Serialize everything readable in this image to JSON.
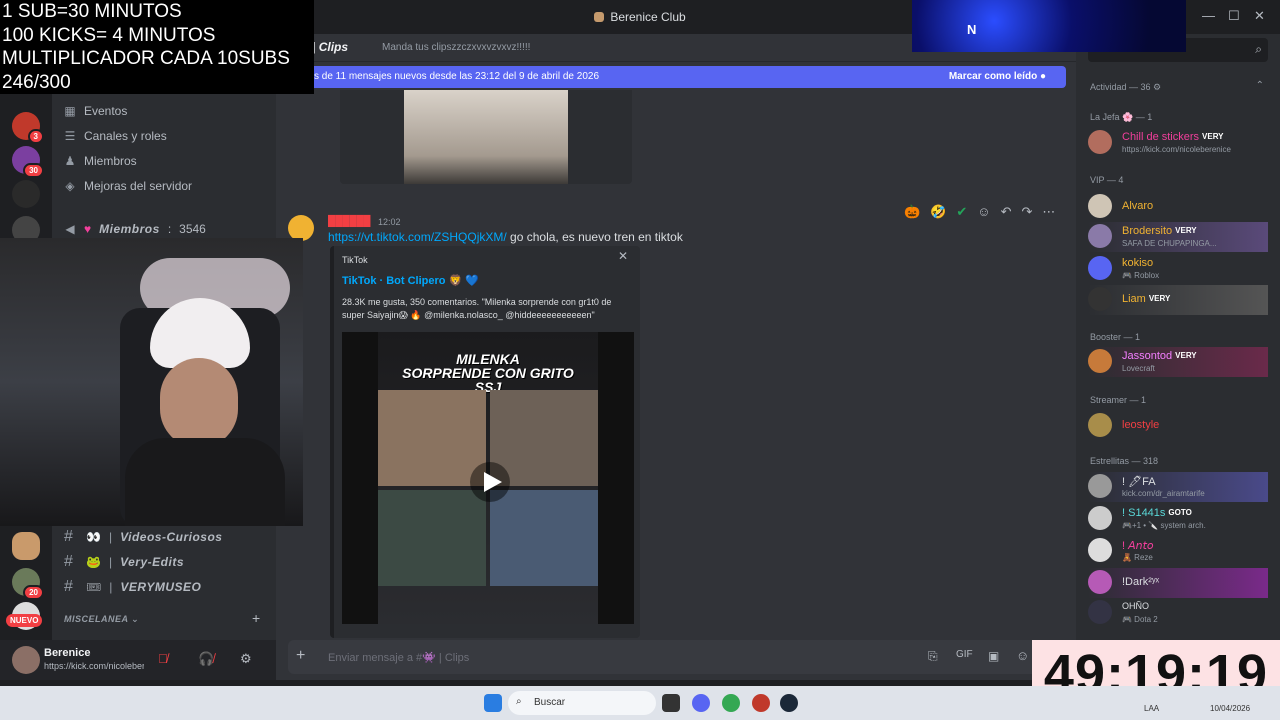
{
  "window": {
    "title": "Berenice Club",
    "controls": [
      "—",
      "☐",
      "✕"
    ]
  },
  "overlay": {
    "lines": [
      "1 SUB=30 MINUTOS",
      "100 KICKS= 4 MINUTOS",
      "MULTIPLICADOR CADA 10SUBS",
      "246/300"
    ],
    "timer": "49:19:19",
    "neon_text": "N"
  },
  "rail": {
    "badges": [
      "3",
      "30",
      "20"
    ],
    "new_pill": "NUEVO"
  },
  "sidebar": {
    "items": [
      {
        "icon": "calendar-icon",
        "label": "Eventos"
      },
      {
        "icon": "list-icon",
        "label": "Canales y roles"
      },
      {
        "icon": "people-icon",
        "label": "Miembros"
      },
      {
        "icon": "shield-icon",
        "label": "Mejoras del servidor"
      }
    ],
    "members_stat": {
      "label": "Miembros",
      "count": "3546"
    },
    "channels": [
      {
        "emoji": "👀",
        "name": "Videos-Curiosos"
      },
      {
        "emoji": "🐸",
        "name": "Very-Edits"
      },
      {
        "emoji": "🎟",
        "name": "VERYMUSEO"
      }
    ],
    "section": "MISCELANEA"
  },
  "user_panel": {
    "name": "Berenice",
    "status": "https://kick.com/nicoleber"
  },
  "chat": {
    "channel_name": "Clips",
    "topic": "Manda tus clipszzczxvxvzvxvz!!!!!",
    "new_messages": "s de 11 mensajes nuevos desde las 23:12 del 9 de abril de 2026",
    "mark_read": "Marcar como leído",
    "message": {
      "author": "██████",
      "time": "12:02",
      "link": "https://vt.tiktok.com/ZSHQQjkXM/",
      "text": " go chola, es nuevo tren en tiktok"
    },
    "embed": {
      "provider": "TikTok",
      "title": "TikTok · Bot Clipero 🦁 💙",
      "description": "28.3K me gusta, 350 comentarios. \"Milenka sorprende con gr1t0 de super Saiyajin😱 🔥 @milenka.nolasco_ @hiddeeeeeeeeeeen\"",
      "video_title": [
        "MILENKA",
        "SORPRENDE CON GRITO",
        "SSJ"
      ]
    },
    "composer_placeholder": "Enviar mensaje a #👾 | Clips"
  },
  "members": {
    "groups": [
      {
        "title": "Actividad — 36",
        "members": []
      },
      {
        "title": "La Jefa 🌸 — 1",
        "members": [
          {
            "name": "Chill de stickers",
            "tag": "VERY",
            "sub": "https://kick.com/nicoleberenice",
            "color": "#f23f9c"
          }
        ]
      },
      {
        "title": "VIP — 4",
        "members": [
          {
            "name": "Alvaro",
            "tag": "",
            "sub": "",
            "color": "#f0b232"
          },
          {
            "name": "Brodersito",
            "tag": "VERY",
            "sub": "SAFA DE CHUPAPINGA...",
            "color": "#f0b232"
          },
          {
            "name": "kokiso",
            "tag": "",
            "sub": "🎮 Roblox",
            "color": "#f0b232"
          },
          {
            "name": "Liam",
            "tag": "VERY",
            "sub": "",
            "color": "#f0b232"
          }
        ]
      },
      {
        "title": "Booster — 1",
        "members": [
          {
            "name": "Jassontod",
            "tag": "VERY",
            "sub": "Lovecraft",
            "color": "#f47fff"
          }
        ]
      },
      {
        "title": "Streamer — 1",
        "members": [
          {
            "name": "leostyle",
            "tag": "",
            "sub": "",
            "color": "#f23f43"
          }
        ]
      },
      {
        "title": "Estrellitas — 318",
        "members": [
          {
            "name": "! 🖊FA",
            "tag": "",
            "sub": "kick.com/dr_airamtarife",
            "color": "#dbdee1"
          },
          {
            "name": "! S1441s",
            "tag": "GOTO",
            "sub": "🎮+1 • 🔪 system arch.",
            "color": "#5ad8d8"
          },
          {
            "name": "! 𝘈𝘯𝘵𝘰",
            "tag": "",
            "sub": "🧸 Reze",
            "color": "#f23f9c"
          },
          {
            "name": "!Dark²ʸˣ",
            "tag": "",
            "sub": "",
            "color": "#dbdee1"
          },
          {
            "name": "OHÑO",
            "tag": "",
            "sub": "🎮 Dota 2",
            "color": "#dbdee1"
          }
        ]
      }
    ]
  },
  "taskbar": {
    "search_placeholder": "Buscar",
    "lang": "LAA",
    "date": "10/04/2026"
  },
  "colors": {
    "accent": "#5865f2",
    "link": "#00a8fc",
    "timer_bg": "#fde2e4"
  }
}
